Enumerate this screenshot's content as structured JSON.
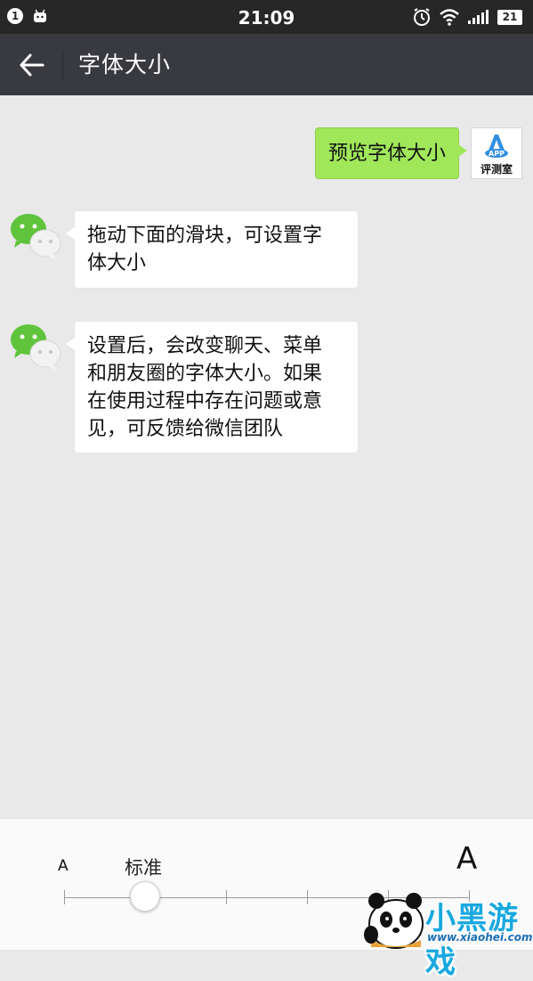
{
  "status_bar": {
    "notification_badge": "1",
    "time": "21:09",
    "battery": "21",
    "icons": [
      "notification-badge-icon",
      "android-icon",
      "alarm-icon",
      "wifi-icon",
      "signal-icon",
      "battery-icon"
    ]
  },
  "header": {
    "title": "字体大小",
    "back_icon": "arrow-left-icon"
  },
  "chat": {
    "sent_message": "预览字体大小",
    "sent_avatar": {
      "logo_letters": "APP",
      "label": "评测室"
    },
    "received_messages": [
      {
        "lines": [
          "拖动下面的滑块，可设置字",
          "体大小"
        ]
      },
      {
        "lines": [
          "设置后，会改变聊天、菜单",
          "和朋友圈的字体大小。如果",
          "在使用过程中存在问题或意",
          "见，可反馈给微信团队"
        ]
      }
    ]
  },
  "font_slider": {
    "small_label": "A",
    "standard_label": "标准",
    "large_label": "A",
    "levels": 6,
    "selected_level": 1
  },
  "watermark": {
    "text": "小黑游戏",
    "url": "www.xiaohei.com"
  },
  "colors": {
    "status_bar": "#272727",
    "title_bar": "#393a3f",
    "sent_bubble": "#a0e75a",
    "received_bubble": "#ffffff",
    "chat_background": "#e9e9e9",
    "wechat_green": "#5fc43c"
  }
}
